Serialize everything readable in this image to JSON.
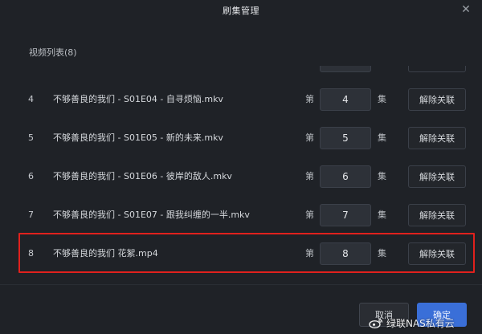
{
  "dialog": {
    "title": "刷集管理",
    "close_symbol": "✕"
  },
  "section": {
    "label": "视频列表(8)"
  },
  "labels": {
    "episode_prefix": "第",
    "episode_suffix": "集",
    "unlink": "解除关联"
  },
  "rows": [
    {
      "index": "4",
      "filename": "不够善良的我们 - S01E04 - 自寻烦恼.mkv",
      "episode": "4"
    },
    {
      "index": "5",
      "filename": "不够善良的我们 - S01E05 - 新的未来.mkv",
      "episode": "5"
    },
    {
      "index": "6",
      "filename": "不够善良的我们 - S01E06 - 彼岸的敌人.mkv",
      "episode": "6"
    },
    {
      "index": "7",
      "filename": "不够善良的我们 - S01E07 - 跟我纠缠的一半.mkv",
      "episode": "7"
    },
    {
      "index": "8",
      "filename": "不够善良的我们 花絮.mp4",
      "episode": "8"
    }
  ],
  "footer": {
    "cancel": "取消",
    "confirm": "确定"
  },
  "watermark": {
    "text": "绿联NAS私有云"
  },
  "colors": {
    "accent": "#3a6fd8",
    "highlight": "#e0211d",
    "background": "#1f2227"
  },
  "icons": {
    "close": "close-icon",
    "watermark": "weibo-icon"
  }
}
